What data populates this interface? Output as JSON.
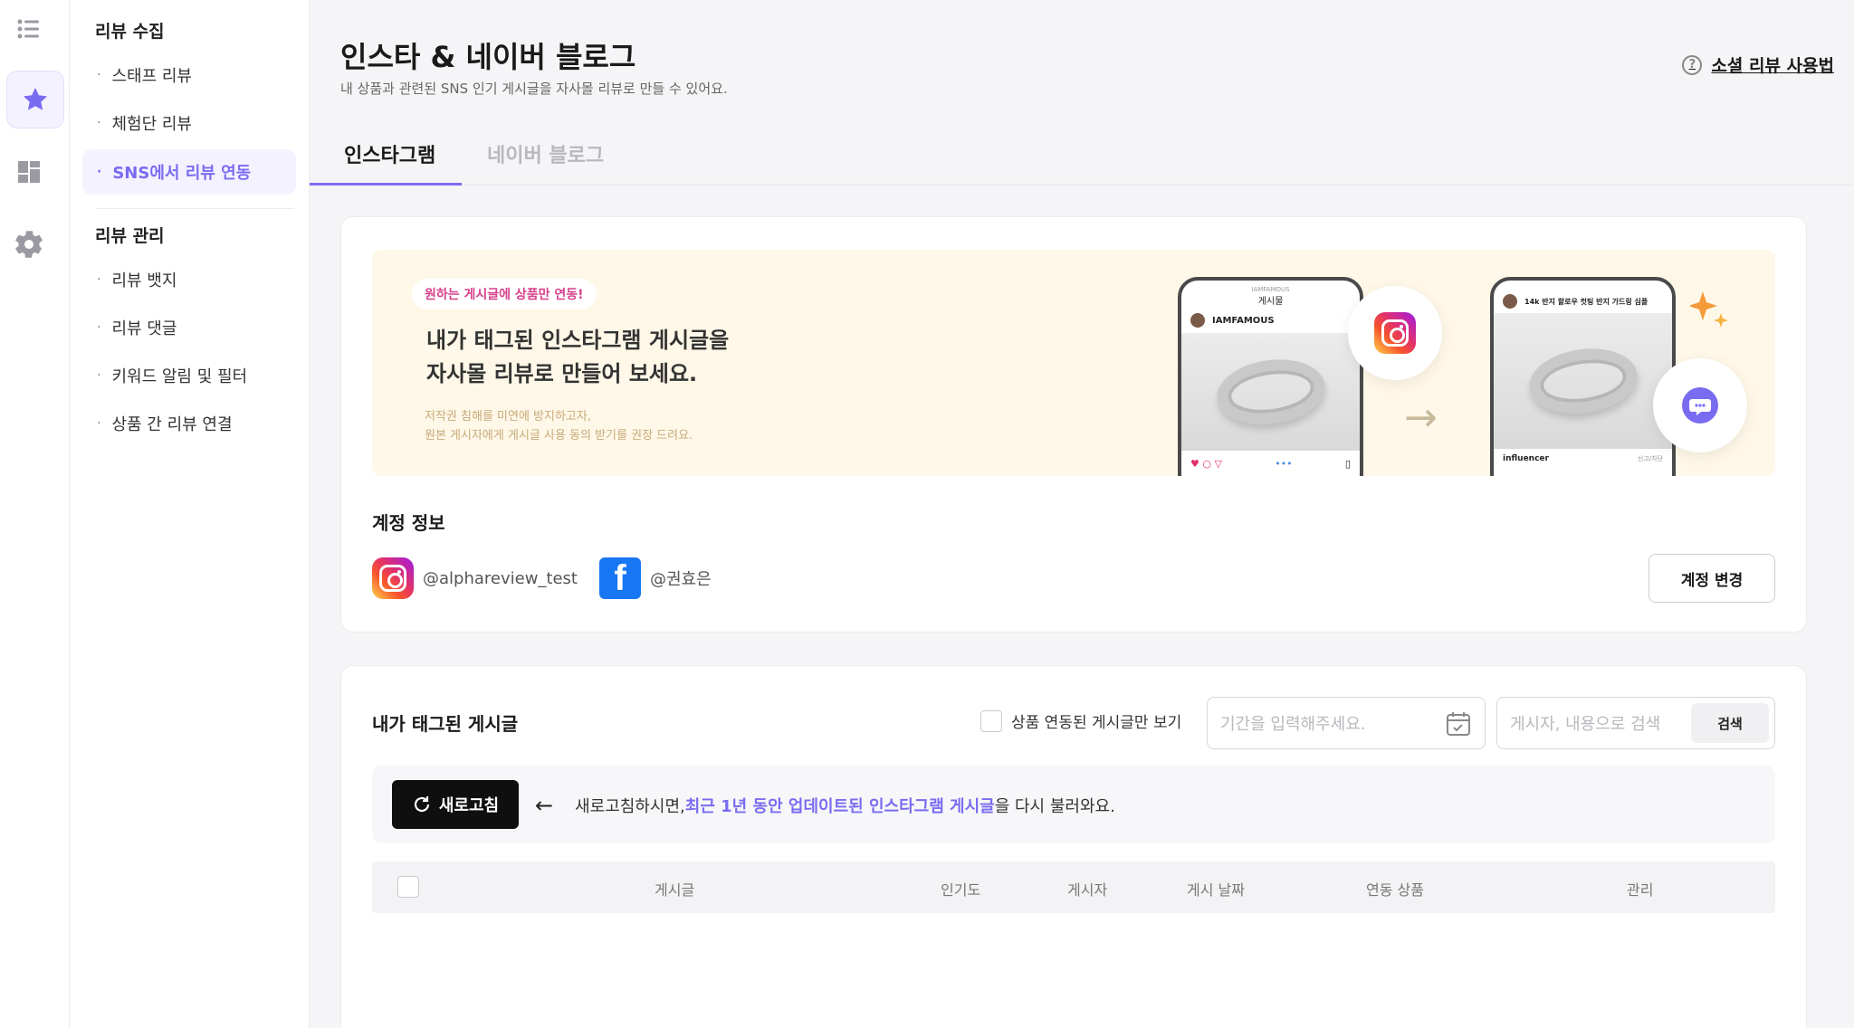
{
  "rail": {
    "items": [
      {
        "icon": "list-icon",
        "active": false
      },
      {
        "icon": "star-icon",
        "active": true
      },
      {
        "icon": "dashboard-icon",
        "active": false
      },
      {
        "icon": "gear-icon",
        "active": false
      }
    ]
  },
  "sidebar": {
    "section1": "리뷰 수집",
    "items1": [
      {
        "label": "스태프 리뷰"
      },
      {
        "label": "체험단 리뷰"
      },
      {
        "label": "SNS에서 리뷰 연동",
        "active": true
      }
    ],
    "section2": "리뷰 관리",
    "items2": [
      {
        "label": "리뷰 뱃지"
      },
      {
        "label": "리뷰 댓글"
      },
      {
        "label": "키워드 알림 및 필터"
      },
      {
        "label": "상품 간 리뷰 연결"
      }
    ],
    "bullet": "·"
  },
  "header": {
    "title": "인스타 & 네이버 블로그",
    "subtitle": "내 상품과 관련된 SNS 인기 게시글을 자사몰 리뷰로 만들 수 있어요.",
    "help_icon": "?",
    "help_label": "소셜 리뷰 사용법"
  },
  "tabs": [
    {
      "label": "인스타그램",
      "active": true
    },
    {
      "label": "네이버 블로그",
      "active": false
    }
  ],
  "banner": {
    "pill": "원하는 게시글에 상품만 연동!",
    "headline1": "내가 태그된 인스타그램 게시글을",
    "headline2": "자사몰 리뷰로 만들어 보세요.",
    "note1": "저작권 침해를 미연에 방지하고자,",
    "note2": "원본 게시자에게 게시글 사용 동의 받기를 권장 드려요.",
    "phone1_brand": "IAMFAMOUS",
    "phone1_top": "게시물",
    "phone1_user": "IAMFAMOUS",
    "phone2_title": "14k 반지 할로우 컷팅 반지 가드링 심플",
    "phone2_user": "influencer",
    "phone2_tag": "신고/차단",
    "arrow": "→",
    "accent_bg": "#fff8e8"
  },
  "account": {
    "heading": "계정 정보",
    "instagram": "@alphareview_test",
    "facebook": "@권효은",
    "facebook_letter": "f",
    "change_button": "계정 변경"
  },
  "posts": {
    "heading": "내가 태그된 게시글",
    "filter_label": "상품 연동된 게시글만 보기",
    "date_placeholder": "기간을 입력해주세요.",
    "search_placeholder": "게시자, 내용으로 검색",
    "search_button": "검색",
    "refresh_button": "새로고침",
    "refresh_arrow": "←",
    "refresh_pre": "새로고침하시면, ",
    "refresh_highlight": "최근 1년 동안 업데이트된 인스타그램 게시글",
    "refresh_post": "을 다시 불러와요.",
    "columns": [
      "게시글",
      "인기도",
      "게시자",
      "게시 날짜",
      "연동 상품",
      "관리"
    ]
  },
  "colors": {
    "accent": "#7a6cf0",
    "dark_button": "#0f0f0f",
    "instagram_pink": "#e1306c",
    "facebook_blue": "#1877f2"
  }
}
